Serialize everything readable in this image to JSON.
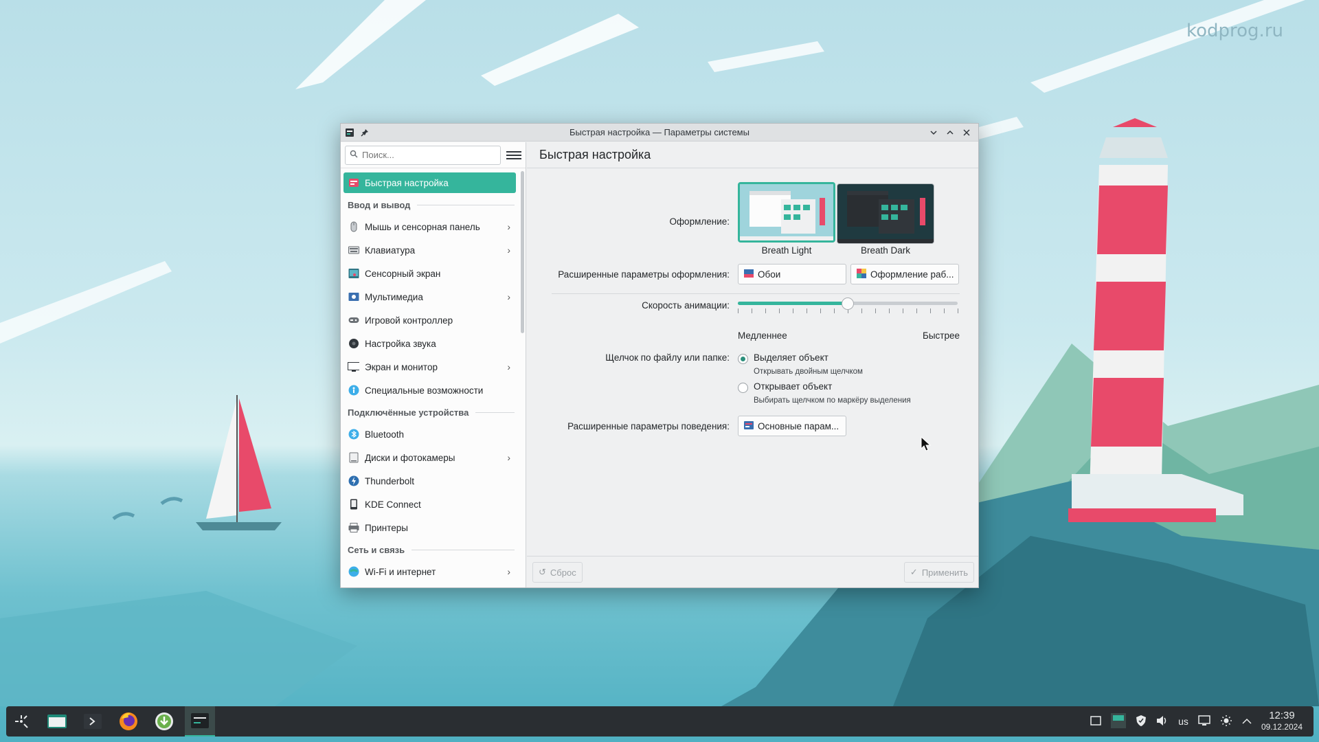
{
  "desktop": {
    "watermark": "kodprog.ru"
  },
  "window": {
    "title": "Быстрая настройка — Параметры системы",
    "search_placeholder": "Поиск...",
    "sidebar": {
      "active_item": "Быстрая настройка",
      "sections": [
        {
          "heading": "Ввод и вывод",
          "items": [
            {
              "label": "Мышь и сенсорная панель",
              "icon": "mouse-icon",
              "chevron": true
            },
            {
              "label": "Клавиатура",
              "icon": "keyboard-icon",
              "chevron": true
            },
            {
              "label": "Сенсорный экран",
              "icon": "touchscreen-icon",
              "chevron": false
            },
            {
              "label": "Мультимедиа",
              "icon": "multimedia-icon",
              "chevron": true
            },
            {
              "label": "Игровой контроллер",
              "icon": "gamepad-icon",
              "chevron": false
            },
            {
              "label": "Настройка звука",
              "icon": "audio-icon",
              "chevron": false
            },
            {
              "label": "Экран и монитор",
              "icon": "monitor-icon",
              "chevron": true
            },
            {
              "label": "Специальные возможности",
              "icon": "accessibility-icon",
              "chevron": false
            }
          ]
        },
        {
          "heading": "Подключённые устройства",
          "items": [
            {
              "label": "Bluetooth",
              "icon": "bluetooth-icon",
              "chevron": false
            },
            {
              "label": "Диски и фотокамеры",
              "icon": "disk-icon",
              "chevron": true
            },
            {
              "label": "Thunderbolt",
              "icon": "thunderbolt-icon",
              "chevron": false
            },
            {
              "label": "KDE Connect",
              "icon": "phone-icon",
              "chevron": false
            },
            {
              "label": "Принтеры",
              "icon": "printer-icon",
              "chevron": false
            }
          ]
        },
        {
          "heading": "Сеть и связь",
          "items": [
            {
              "label": "Wi-Fi и интернет",
              "icon": "wifi-icon",
              "chevron": true
            }
          ]
        }
      ]
    },
    "content": {
      "header": "Быстрая настройка",
      "theme_label": "Оформление:",
      "themes": [
        "Breath Light",
        "Breath Dark"
      ],
      "selected_theme": "Breath Light",
      "advanced_theme_label": "Расширенные параметры оформления:",
      "wallpaper_button": "Обои",
      "workspace_theme_button": "Оформление раб...",
      "animation_label": "Скорость анимации:",
      "animation_slower": "Медленнее",
      "animation_faster": "Быстрее",
      "animation_speed_fraction": 0.5,
      "click_label": "Щелчок по файлу или папке:",
      "click_options": [
        {
          "label": "Выделяет объект",
          "hint": "Открывать двойным щелчком",
          "selected": true
        },
        {
          "label": "Открывает объект",
          "hint": "Выбирать щелчком по маркёру выделения",
          "selected": false
        }
      ],
      "advanced_behavior_label": "Расширенные параметры поведения:",
      "behavior_button": "Основные парам...",
      "reset_button": "Сброс",
      "apply_button": "Применить"
    }
  },
  "taskbar": {
    "keyboard_layout": "us",
    "time": "12:39",
    "date": "09.12.2024"
  },
  "colors": {
    "accent": "#35b59c",
    "taskbar": "#2a2e32"
  }
}
